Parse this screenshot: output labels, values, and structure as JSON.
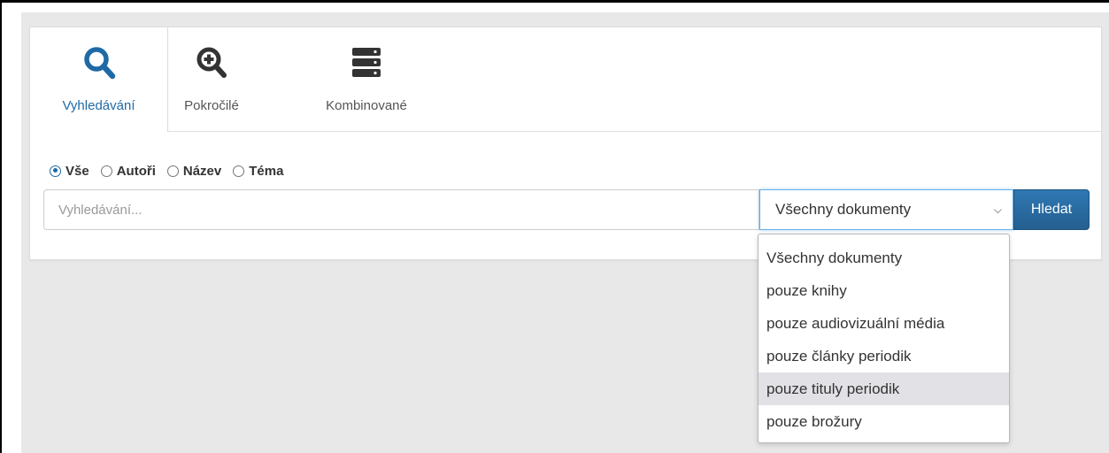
{
  "tabs": [
    {
      "label": "Vyhledávání",
      "icon": "search-icon",
      "active": true
    },
    {
      "label": "Pokročilé",
      "icon": "zoom-in-icon",
      "active": false
    },
    {
      "label": "Kombinované",
      "icon": "server-icon",
      "active": false
    }
  ],
  "scope_options": [
    {
      "label": "Vše",
      "checked": true
    },
    {
      "label": "Autoři",
      "checked": false
    },
    {
      "label": "Název",
      "checked": false
    },
    {
      "label": "Téma",
      "checked": false
    }
  ],
  "search": {
    "placeholder": "Vyhledávání...",
    "value": "",
    "button_label": "Hledat"
  },
  "document_type": {
    "selected": "Všechny dokumenty",
    "options": [
      "Všechny dokumenty",
      "pouze knihy",
      "pouze audiovizuální média",
      "pouze články periodik",
      "pouze tituly periodik",
      "pouze brožury"
    ],
    "highlighted_option": "pouze tituly periodik"
  },
  "colors": {
    "accent": "#1e6aa6",
    "button": "#2a6ca3",
    "page_background": "#e8e8e8"
  }
}
